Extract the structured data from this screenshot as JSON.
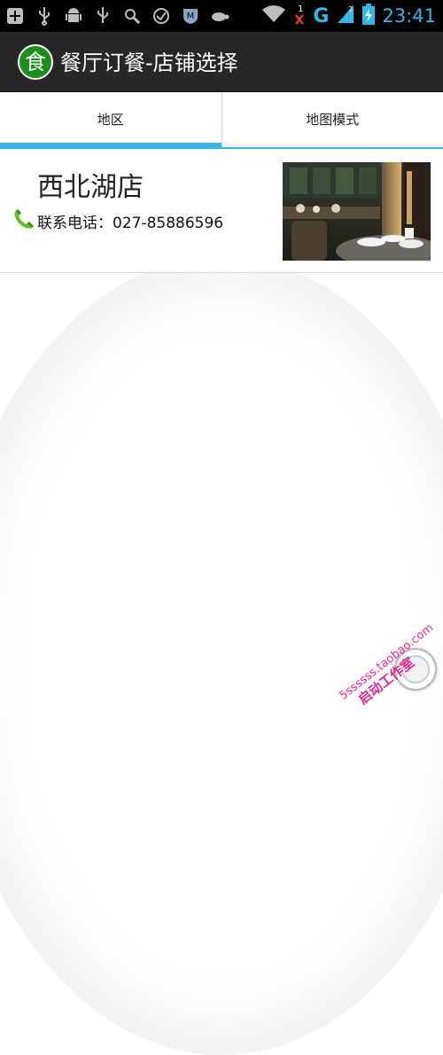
{
  "status_bar": {
    "time": "23:41",
    "network": "G",
    "icons": [
      "notification-plus-icon",
      "usb-icon",
      "android-icon",
      "usb-icon",
      "search-icon",
      "check-circle-icon",
      "shield-m-icon",
      "turtle-icon",
      "wifi-icon",
      "no-signal-icon",
      "signal-icon",
      "battery-charging-icon"
    ]
  },
  "action_bar": {
    "app_icon_char": "食",
    "title": "餐厅订餐-店铺选择"
  },
  "tabs": [
    {
      "label": "地区",
      "active": true
    },
    {
      "label": "地图模式",
      "active": false
    }
  ],
  "stores": [
    {
      "name": "西北湖店",
      "phone": "联系电话：027-85886596"
    }
  ],
  "watermark": {
    "line1": "5ssssss.taobao.com",
    "line2": "启动工作室"
  },
  "colors": {
    "accent": "#33b5e5",
    "action_bar": "#272727",
    "app_icon": "#1d8e1d",
    "phone_green": "#4caf1a"
  }
}
